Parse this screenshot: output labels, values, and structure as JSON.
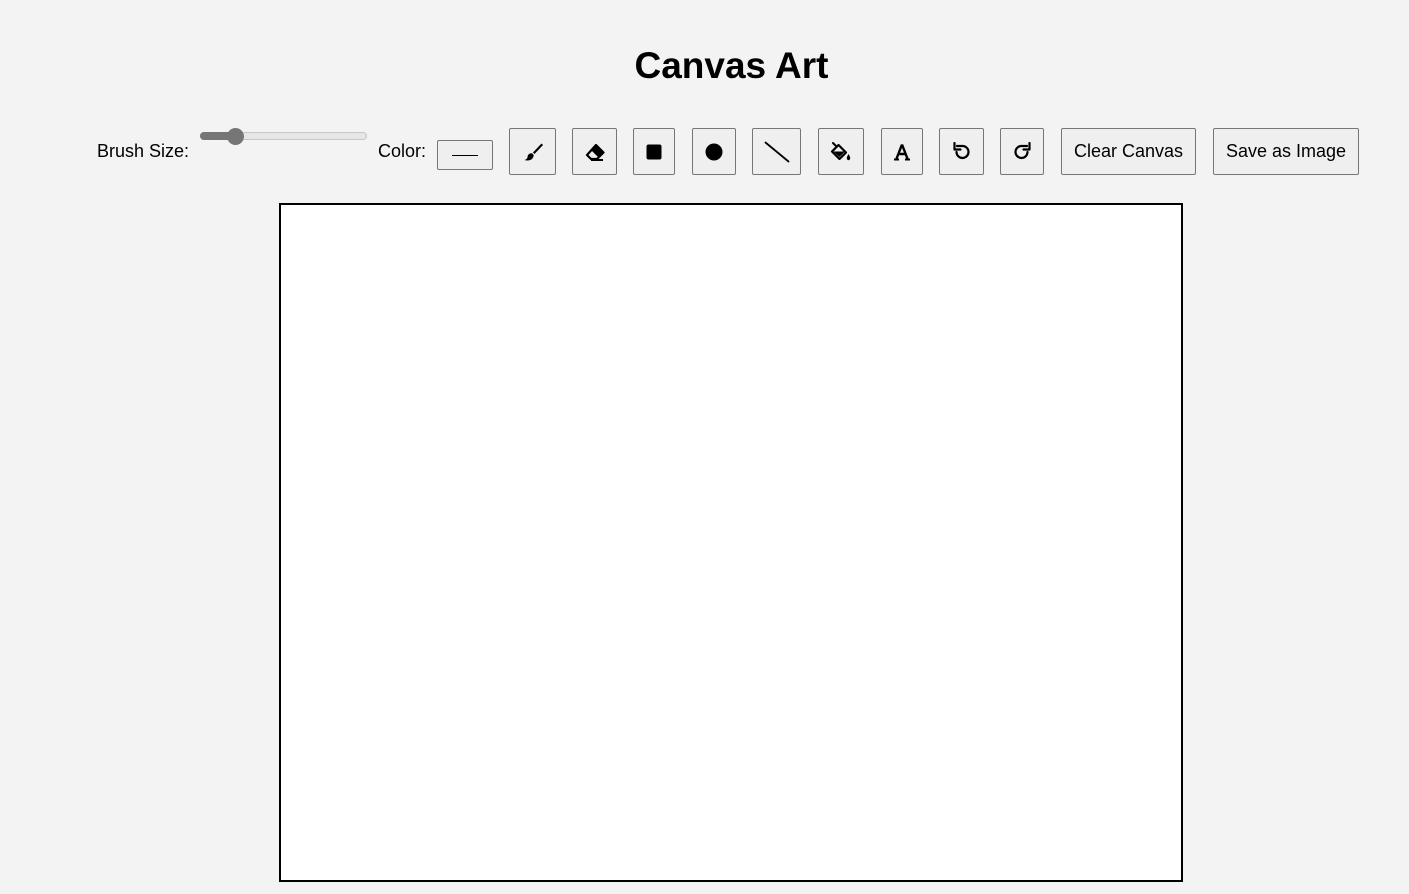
{
  "app": {
    "title": "Canvas Art"
  },
  "toolbar": {
    "brush_size_label": "Brush Size:",
    "brush_size_fraction": 0.18,
    "color_label": "Color:",
    "color_value": "#000000",
    "tools": [
      {
        "name": "brush",
        "icon": "paintbrush-icon"
      },
      {
        "name": "eraser",
        "icon": "eraser-icon"
      },
      {
        "name": "rectangle",
        "icon": "square-icon"
      },
      {
        "name": "circle",
        "icon": "circle-icon"
      },
      {
        "name": "line",
        "icon": "line-icon"
      },
      {
        "name": "fill",
        "icon": "paint-bucket-icon"
      },
      {
        "name": "text",
        "icon": "text-icon"
      },
      {
        "name": "undo",
        "icon": "undo-icon"
      },
      {
        "name": "redo",
        "icon": "redo-icon"
      }
    ],
    "clear_label": "Clear Canvas",
    "save_label": "Save as Image"
  },
  "colors": {
    "background": "#f3f3f3",
    "canvas": "#ffffff",
    "canvas_border": "#000000",
    "button_bg": "#efefef",
    "slider_accent": "#767676"
  }
}
